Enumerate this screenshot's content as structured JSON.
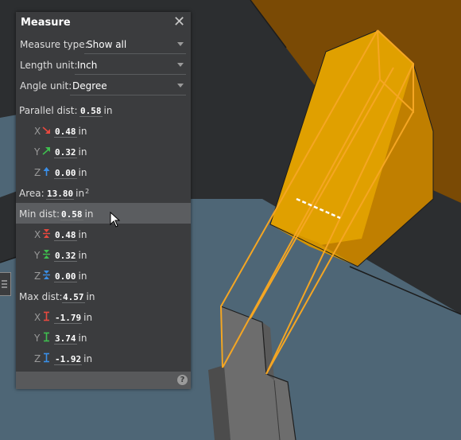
{
  "panel": {
    "title": "Measure",
    "dropdowns": [
      {
        "label": "Measure type:",
        "value": "Show all"
      },
      {
        "label": "Length unit:",
        "value": "Inch"
      },
      {
        "label": "Angle unit:",
        "value": "Degree"
      }
    ],
    "parallel": {
      "label": "Parallel dist:",
      "value": "0.58",
      "unit": "in",
      "components": [
        {
          "axis": "X",
          "value": "0.48",
          "unit": "in",
          "icon": "diagonal-down-arrow-icon",
          "color": "#e8493f"
        },
        {
          "axis": "Y",
          "value": "0.32",
          "unit": "in",
          "icon": "diagonal-up-arrow-icon",
          "color": "#3fbf4f"
        },
        {
          "axis": "Z",
          "value": "0.00",
          "unit": "in",
          "icon": "up-arrow-icon",
          "color": "#3a8fe8"
        }
      ]
    },
    "area": {
      "label": "Area:",
      "value": "13.80",
      "unit": "in",
      "exponent": "2"
    },
    "min": {
      "label": "Min dist:",
      "value": "0.58",
      "unit": "in",
      "components": [
        {
          "axis": "X",
          "value": "0.48",
          "unit": "in",
          "icon": "min-dist-icon",
          "color": "#e8493f"
        },
        {
          "axis": "Y",
          "value": "0.32",
          "unit": "in",
          "icon": "min-dist-icon",
          "color": "#3fbf4f"
        },
        {
          "axis": "Z",
          "value": "0.00",
          "unit": "in",
          "icon": "min-dist-icon",
          "color": "#3a8fe8"
        }
      ]
    },
    "max": {
      "label": "Max dist:",
      "value": "4.57",
      "unit": "in",
      "components": [
        {
          "axis": "X",
          "value": "-1.79",
          "unit": "in",
          "icon": "max-dist-icon",
          "color": "#e8493f"
        },
        {
          "axis": "Y",
          "value": "3.74",
          "unit": "in",
          "icon": "max-dist-icon",
          "color": "#3fbf4f"
        },
        {
          "axis": "Z",
          "value": "-1.92",
          "unit": "in",
          "icon": "max-dist-icon",
          "color": "#3a8fe8"
        }
      ]
    },
    "help_icon": "?"
  },
  "colors": {
    "panel_bg": "#3b3c3e",
    "highlight_row": "#5b5d60",
    "selection_orange": "#f5a623",
    "part_yellow": "#e0a000",
    "background_part_blue": "#4d6575",
    "background_part_brown": "#7a4a05"
  }
}
